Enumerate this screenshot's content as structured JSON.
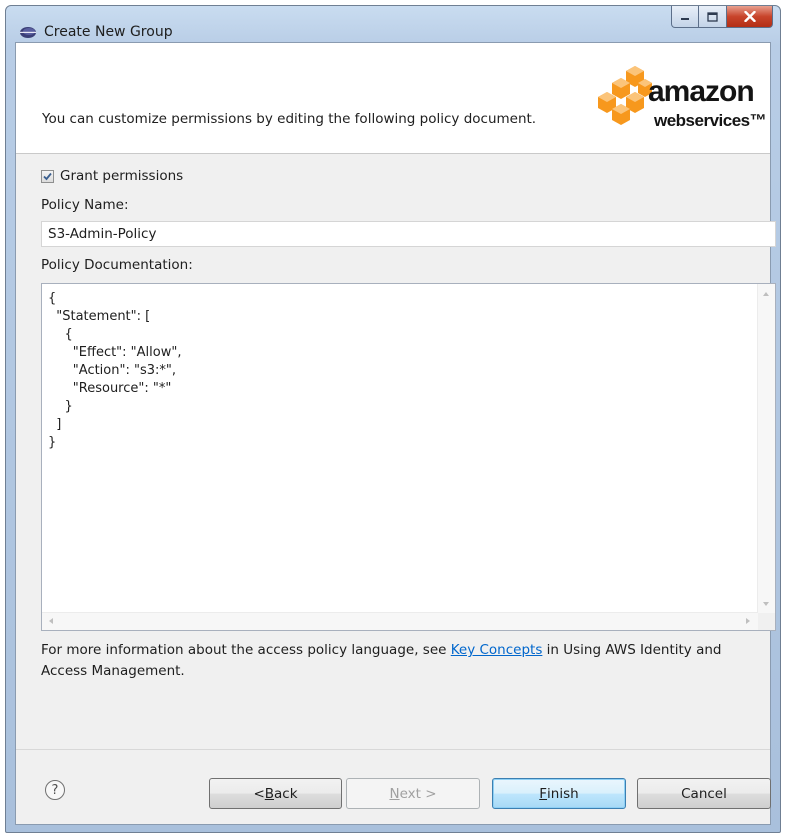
{
  "window": {
    "title": "Create New Group"
  },
  "banner": {
    "description": "You can customize permissions by editing the following policy document.",
    "logo_amazon": "amazon",
    "logo_webservices": "webservices™"
  },
  "form": {
    "grant_label": "Grant permissions",
    "grant_checked": true,
    "policy_name_label": "Policy Name:",
    "policy_name_value": "S3-Admin-Policy",
    "policy_doc_label": "Policy Documentation:",
    "policy_doc_value": "{\n  \"Statement\": [\n    {\n      \"Effect\": \"Allow\",\n      \"Action\": \"s3:*\",\n      \"Resource\": \"*\"\n    }\n  ]\n}"
  },
  "info": {
    "prefix": "For more information about the access policy language, see ",
    "link": "Key Concepts",
    "suffix": " in Using AWS Identity and Access Management."
  },
  "buttons": {
    "back_prefix": "< ",
    "back_mnemonic": "B",
    "back_rest": "ack",
    "next_mnemonic": "N",
    "next_rest": "ext >",
    "finish_mnemonic": "F",
    "finish_rest": "inish",
    "cancel": "Cancel",
    "help": "?"
  },
  "colors": {
    "link": "#0066cc",
    "close_button": "#c8442b",
    "aws_orange": "#f7981d"
  },
  "icons": {
    "app": "eclipse-icon",
    "minimize": "minimize-icon",
    "maximize": "maximize-icon",
    "close": "close-icon",
    "help": "help-icon",
    "checkbox": "checkmark-icon"
  }
}
